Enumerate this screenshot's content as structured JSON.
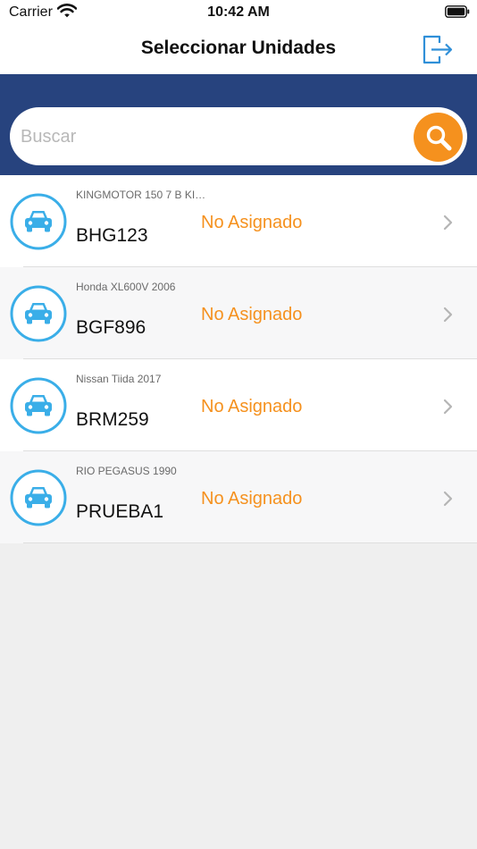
{
  "status_bar": {
    "carrier": "Carrier",
    "time": "10:42 AM"
  },
  "header": {
    "title": "Seleccionar Unidades",
    "logout_icon": "logout-icon"
  },
  "search": {
    "placeholder": "Buscar",
    "value": "",
    "icon": "search-icon"
  },
  "colors": {
    "accent": "#f5911e",
    "band": "#27437e",
    "icon_blue": "#3aaee8",
    "background": "#efefef"
  },
  "units": [
    {
      "model": "KINGMOTOR 150 7 B KI…",
      "plate": "BHG123",
      "status": "No Asignado"
    },
    {
      "model": "Honda XL600V 2006",
      "plate": "BGF896",
      "status": "No Asignado"
    },
    {
      "model": "Nissan Tiida 2017",
      "plate": "BRM259",
      "status": "No Asignado"
    },
    {
      "model": "RIO PEGASUS 1990",
      "plate": "PRUEBA1",
      "status": "No Asignado"
    }
  ]
}
